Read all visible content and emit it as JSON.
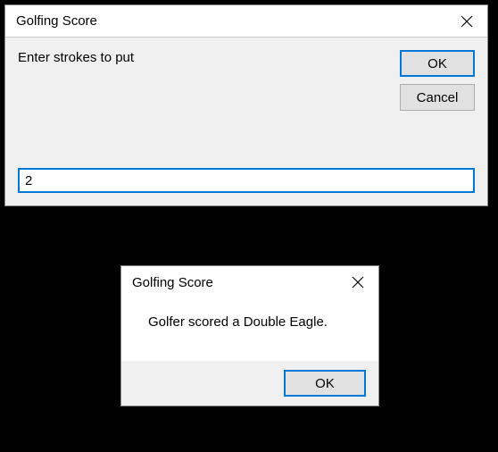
{
  "dialog1": {
    "title": "Golfing Score",
    "prompt": "Enter strokes to put",
    "ok_label": "OK",
    "cancel_label": "Cancel",
    "input_value": "2"
  },
  "dialog2": {
    "title": "Golfing Score",
    "message": "Golfer scored a Double Eagle.",
    "ok_label": "OK"
  }
}
